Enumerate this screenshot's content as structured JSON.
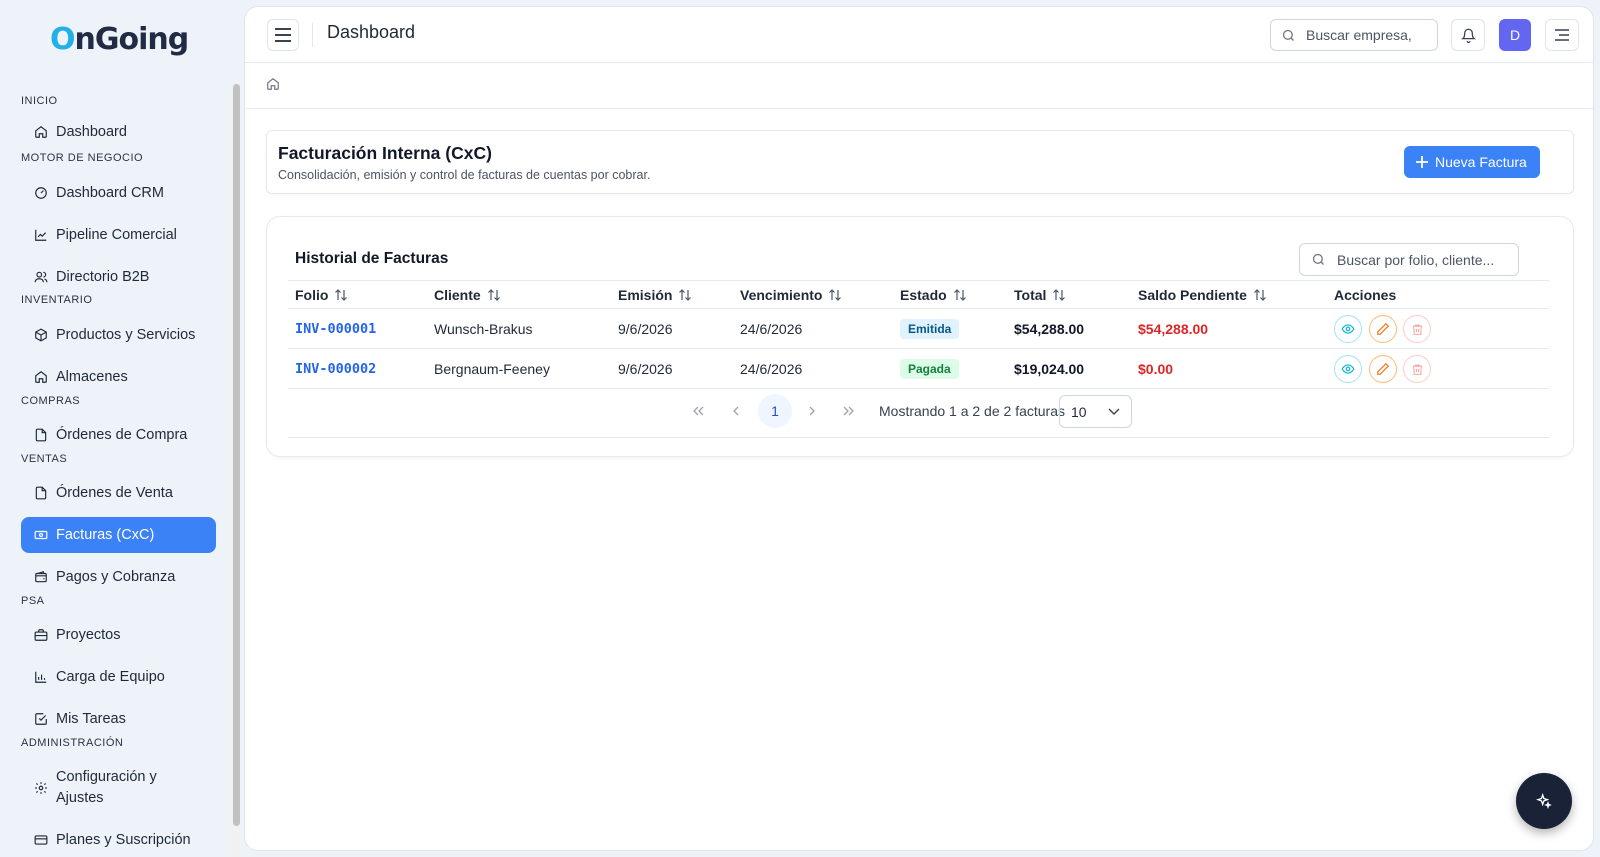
{
  "brand": {
    "logo_first": "O",
    "logo_rest": "nGoing",
    "accent": "#22b0e6"
  },
  "sidebar": {
    "sections": [
      "INICIO",
      "MOTOR DE NEGOCIO",
      "INVENTARIO",
      "COMPRAS",
      "VENTAS",
      "PSA",
      "ADMINISTRACIÓN"
    ],
    "items": [
      {
        "label": "Dashboard",
        "icon": "home-icon"
      },
      {
        "label": "Dashboard CRM",
        "icon": "gauge-icon"
      },
      {
        "label": "Pipeline Comercial",
        "icon": "trend-icon"
      },
      {
        "label": "Directorio B2B",
        "icon": "users-icon"
      },
      {
        "label": "Productos y Servicios",
        "icon": "box-icon"
      },
      {
        "label": "Almacenes",
        "icon": "warehouse-icon"
      },
      {
        "label": "Órdenes de Compra",
        "icon": "file-icon"
      },
      {
        "label": "Órdenes de Venta",
        "icon": "file-icon"
      },
      {
        "label": "Facturas (CxC)",
        "icon": "banknote-icon",
        "active": true
      },
      {
        "label": "Pagos y Cobranza",
        "icon": "wallet-icon"
      },
      {
        "label": "Proyectos",
        "icon": "briefcase-icon"
      },
      {
        "label": "Carga de Equipo",
        "icon": "bar-chart-icon"
      },
      {
        "label": "Mis Tareas",
        "icon": "check-square-icon"
      },
      {
        "label": "Configuración y Ajustes",
        "icon": "settings-icon"
      },
      {
        "label": "Planes y Suscripción",
        "icon": "credit-card-icon"
      }
    ]
  },
  "topbar": {
    "title": "Dashboard",
    "search_placeholder": "Buscar empresa,",
    "avatar_initial": "D"
  },
  "header": {
    "title": "Facturación Interna (CxC)",
    "subtitle": "Consolidación, emisión y control de facturas de cuentas por cobrar.",
    "new_button": "Nueva Factura"
  },
  "table": {
    "title": "Historial de Facturas",
    "search_placeholder": "Buscar por folio, cliente...",
    "columns": [
      "Folio",
      "Cliente",
      "Emisión",
      "Vencimiento",
      "Estado",
      "Total",
      "Saldo Pendiente",
      "Acciones"
    ],
    "rows": [
      {
        "folio": "INV-000001",
        "cliente": "Wunsch-Brakus",
        "emision": "9/6/2026",
        "vencimiento": "24/6/2026",
        "estado": "Emitida",
        "total": "$54,288.00",
        "saldo": "$54,288.00"
      },
      {
        "folio": "INV-000002",
        "cliente": "Bergnaum-Feeney",
        "emision": "9/6/2026",
        "vencimiento": "24/6/2026",
        "estado": "Pagada",
        "total": "$19,024.00",
        "saldo": "$0.00"
      }
    ]
  },
  "pagination": {
    "current": "1",
    "info": "Mostrando 1 a 2 de 2 facturas",
    "per_page": "10"
  }
}
